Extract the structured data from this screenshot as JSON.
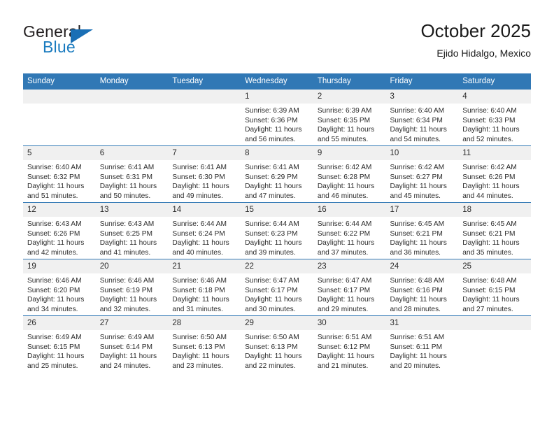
{
  "brand": {
    "name_part1": "General",
    "name_part2": "Blue",
    "triangle_color": "#1a6fb5",
    "blue_color": "#1a7bbf"
  },
  "header": {
    "title": "October 2025",
    "subtitle": "Ejido Hidalgo, Mexico",
    "header_bg": "#3178b5",
    "daynum_bg": "#f0f0f0"
  },
  "weekday_headers": [
    "Sunday",
    "Monday",
    "Tuesday",
    "Wednesday",
    "Thursday",
    "Friday",
    "Saturday"
  ],
  "weeks": [
    [
      {
        "day": "",
        "sunrise": "",
        "sunset": "",
        "daylight_line1": "",
        "daylight_line2": ""
      },
      {
        "day": "",
        "sunrise": "",
        "sunset": "",
        "daylight_line1": "",
        "daylight_line2": ""
      },
      {
        "day": "",
        "sunrise": "",
        "sunset": "",
        "daylight_line1": "",
        "daylight_line2": ""
      },
      {
        "day": "1",
        "sunrise": "Sunrise: 6:39 AM",
        "sunset": "Sunset: 6:36 PM",
        "daylight_line1": "Daylight: 11 hours",
        "daylight_line2": "and 56 minutes."
      },
      {
        "day": "2",
        "sunrise": "Sunrise: 6:39 AM",
        "sunset": "Sunset: 6:35 PM",
        "daylight_line1": "Daylight: 11 hours",
        "daylight_line2": "and 55 minutes."
      },
      {
        "day": "3",
        "sunrise": "Sunrise: 6:40 AM",
        "sunset": "Sunset: 6:34 PM",
        "daylight_line1": "Daylight: 11 hours",
        "daylight_line2": "and 54 minutes."
      },
      {
        "day": "4",
        "sunrise": "Sunrise: 6:40 AM",
        "sunset": "Sunset: 6:33 PM",
        "daylight_line1": "Daylight: 11 hours",
        "daylight_line2": "and 52 minutes."
      }
    ],
    [
      {
        "day": "5",
        "sunrise": "Sunrise: 6:40 AM",
        "sunset": "Sunset: 6:32 PM",
        "daylight_line1": "Daylight: 11 hours",
        "daylight_line2": "and 51 minutes."
      },
      {
        "day": "6",
        "sunrise": "Sunrise: 6:41 AM",
        "sunset": "Sunset: 6:31 PM",
        "daylight_line1": "Daylight: 11 hours",
        "daylight_line2": "and 50 minutes."
      },
      {
        "day": "7",
        "sunrise": "Sunrise: 6:41 AM",
        "sunset": "Sunset: 6:30 PM",
        "daylight_line1": "Daylight: 11 hours",
        "daylight_line2": "and 49 minutes."
      },
      {
        "day": "8",
        "sunrise": "Sunrise: 6:41 AM",
        "sunset": "Sunset: 6:29 PM",
        "daylight_line1": "Daylight: 11 hours",
        "daylight_line2": "and 47 minutes."
      },
      {
        "day": "9",
        "sunrise": "Sunrise: 6:42 AM",
        "sunset": "Sunset: 6:28 PM",
        "daylight_line1": "Daylight: 11 hours",
        "daylight_line2": "and 46 minutes."
      },
      {
        "day": "10",
        "sunrise": "Sunrise: 6:42 AM",
        "sunset": "Sunset: 6:27 PM",
        "daylight_line1": "Daylight: 11 hours",
        "daylight_line2": "and 45 minutes."
      },
      {
        "day": "11",
        "sunrise": "Sunrise: 6:42 AM",
        "sunset": "Sunset: 6:26 PM",
        "daylight_line1": "Daylight: 11 hours",
        "daylight_line2": "and 44 minutes."
      }
    ],
    [
      {
        "day": "12",
        "sunrise": "Sunrise: 6:43 AM",
        "sunset": "Sunset: 6:26 PM",
        "daylight_line1": "Daylight: 11 hours",
        "daylight_line2": "and 42 minutes."
      },
      {
        "day": "13",
        "sunrise": "Sunrise: 6:43 AM",
        "sunset": "Sunset: 6:25 PM",
        "daylight_line1": "Daylight: 11 hours",
        "daylight_line2": "and 41 minutes."
      },
      {
        "day": "14",
        "sunrise": "Sunrise: 6:44 AM",
        "sunset": "Sunset: 6:24 PM",
        "daylight_line1": "Daylight: 11 hours",
        "daylight_line2": "and 40 minutes."
      },
      {
        "day": "15",
        "sunrise": "Sunrise: 6:44 AM",
        "sunset": "Sunset: 6:23 PM",
        "daylight_line1": "Daylight: 11 hours",
        "daylight_line2": "and 39 minutes."
      },
      {
        "day": "16",
        "sunrise": "Sunrise: 6:44 AM",
        "sunset": "Sunset: 6:22 PM",
        "daylight_line1": "Daylight: 11 hours",
        "daylight_line2": "and 37 minutes."
      },
      {
        "day": "17",
        "sunrise": "Sunrise: 6:45 AM",
        "sunset": "Sunset: 6:21 PM",
        "daylight_line1": "Daylight: 11 hours",
        "daylight_line2": "and 36 minutes."
      },
      {
        "day": "18",
        "sunrise": "Sunrise: 6:45 AM",
        "sunset": "Sunset: 6:21 PM",
        "daylight_line1": "Daylight: 11 hours",
        "daylight_line2": "and 35 minutes."
      }
    ],
    [
      {
        "day": "19",
        "sunrise": "Sunrise: 6:46 AM",
        "sunset": "Sunset: 6:20 PM",
        "daylight_line1": "Daylight: 11 hours",
        "daylight_line2": "and 34 minutes."
      },
      {
        "day": "20",
        "sunrise": "Sunrise: 6:46 AM",
        "sunset": "Sunset: 6:19 PM",
        "daylight_line1": "Daylight: 11 hours",
        "daylight_line2": "and 32 minutes."
      },
      {
        "day": "21",
        "sunrise": "Sunrise: 6:46 AM",
        "sunset": "Sunset: 6:18 PM",
        "daylight_line1": "Daylight: 11 hours",
        "daylight_line2": "and 31 minutes."
      },
      {
        "day": "22",
        "sunrise": "Sunrise: 6:47 AM",
        "sunset": "Sunset: 6:17 PM",
        "daylight_line1": "Daylight: 11 hours",
        "daylight_line2": "and 30 minutes."
      },
      {
        "day": "23",
        "sunrise": "Sunrise: 6:47 AM",
        "sunset": "Sunset: 6:17 PM",
        "daylight_line1": "Daylight: 11 hours",
        "daylight_line2": "and 29 minutes."
      },
      {
        "day": "24",
        "sunrise": "Sunrise: 6:48 AM",
        "sunset": "Sunset: 6:16 PM",
        "daylight_line1": "Daylight: 11 hours",
        "daylight_line2": "and 28 minutes."
      },
      {
        "day": "25",
        "sunrise": "Sunrise: 6:48 AM",
        "sunset": "Sunset: 6:15 PM",
        "daylight_line1": "Daylight: 11 hours",
        "daylight_line2": "and 27 minutes."
      }
    ],
    [
      {
        "day": "26",
        "sunrise": "Sunrise: 6:49 AM",
        "sunset": "Sunset: 6:15 PM",
        "daylight_line1": "Daylight: 11 hours",
        "daylight_line2": "and 25 minutes."
      },
      {
        "day": "27",
        "sunrise": "Sunrise: 6:49 AM",
        "sunset": "Sunset: 6:14 PM",
        "daylight_line1": "Daylight: 11 hours",
        "daylight_line2": "and 24 minutes."
      },
      {
        "day": "28",
        "sunrise": "Sunrise: 6:50 AM",
        "sunset": "Sunset: 6:13 PM",
        "daylight_line1": "Daylight: 11 hours",
        "daylight_line2": "and 23 minutes."
      },
      {
        "day": "29",
        "sunrise": "Sunrise: 6:50 AM",
        "sunset": "Sunset: 6:13 PM",
        "daylight_line1": "Daylight: 11 hours",
        "daylight_line2": "and 22 minutes."
      },
      {
        "day": "30",
        "sunrise": "Sunrise: 6:51 AM",
        "sunset": "Sunset: 6:12 PM",
        "daylight_line1": "Daylight: 11 hours",
        "daylight_line2": "and 21 minutes."
      },
      {
        "day": "31",
        "sunrise": "Sunrise: 6:51 AM",
        "sunset": "Sunset: 6:11 PM",
        "daylight_line1": "Daylight: 11 hours",
        "daylight_line2": "and 20 minutes."
      },
      {
        "day": "",
        "sunrise": "",
        "sunset": "",
        "daylight_line1": "",
        "daylight_line2": ""
      }
    ]
  ]
}
